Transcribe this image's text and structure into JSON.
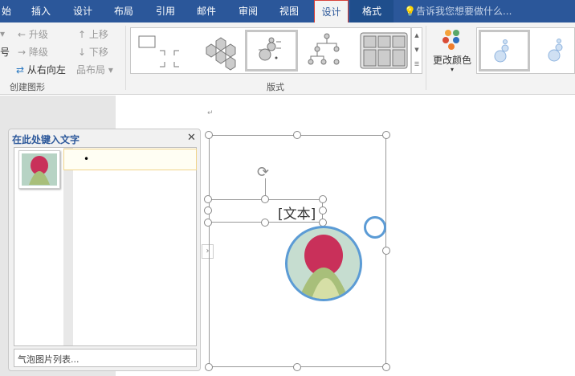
{
  "tabs": [
    "始",
    "插入",
    "设计",
    "布局",
    "引用",
    "邮件",
    "审阅",
    "视图",
    "设计",
    "格式"
  ],
  "active_tab_index": 8,
  "tell_me": "告诉我您想要做什么...",
  "ribbon": {
    "create_graphic": {
      "promote": "升级",
      "demote": "降级",
      "right_to_left": "从右向左",
      "move_up": "上移",
      "move_down": "下移",
      "layout": "布局",
      "bullet_partial": "号",
      "label": "创建图形"
    },
    "layouts": {
      "label": "版式"
    },
    "change_colors": "更改颜色"
  },
  "text_pane": {
    "title": "在此处键入文字",
    "footer": "气泡图片列表...",
    "bullet": "•"
  },
  "smartart": {
    "placeholder": "[文本]"
  },
  "colors": {
    "accent": "#2b579a",
    "circle": "#5b9bd5"
  }
}
